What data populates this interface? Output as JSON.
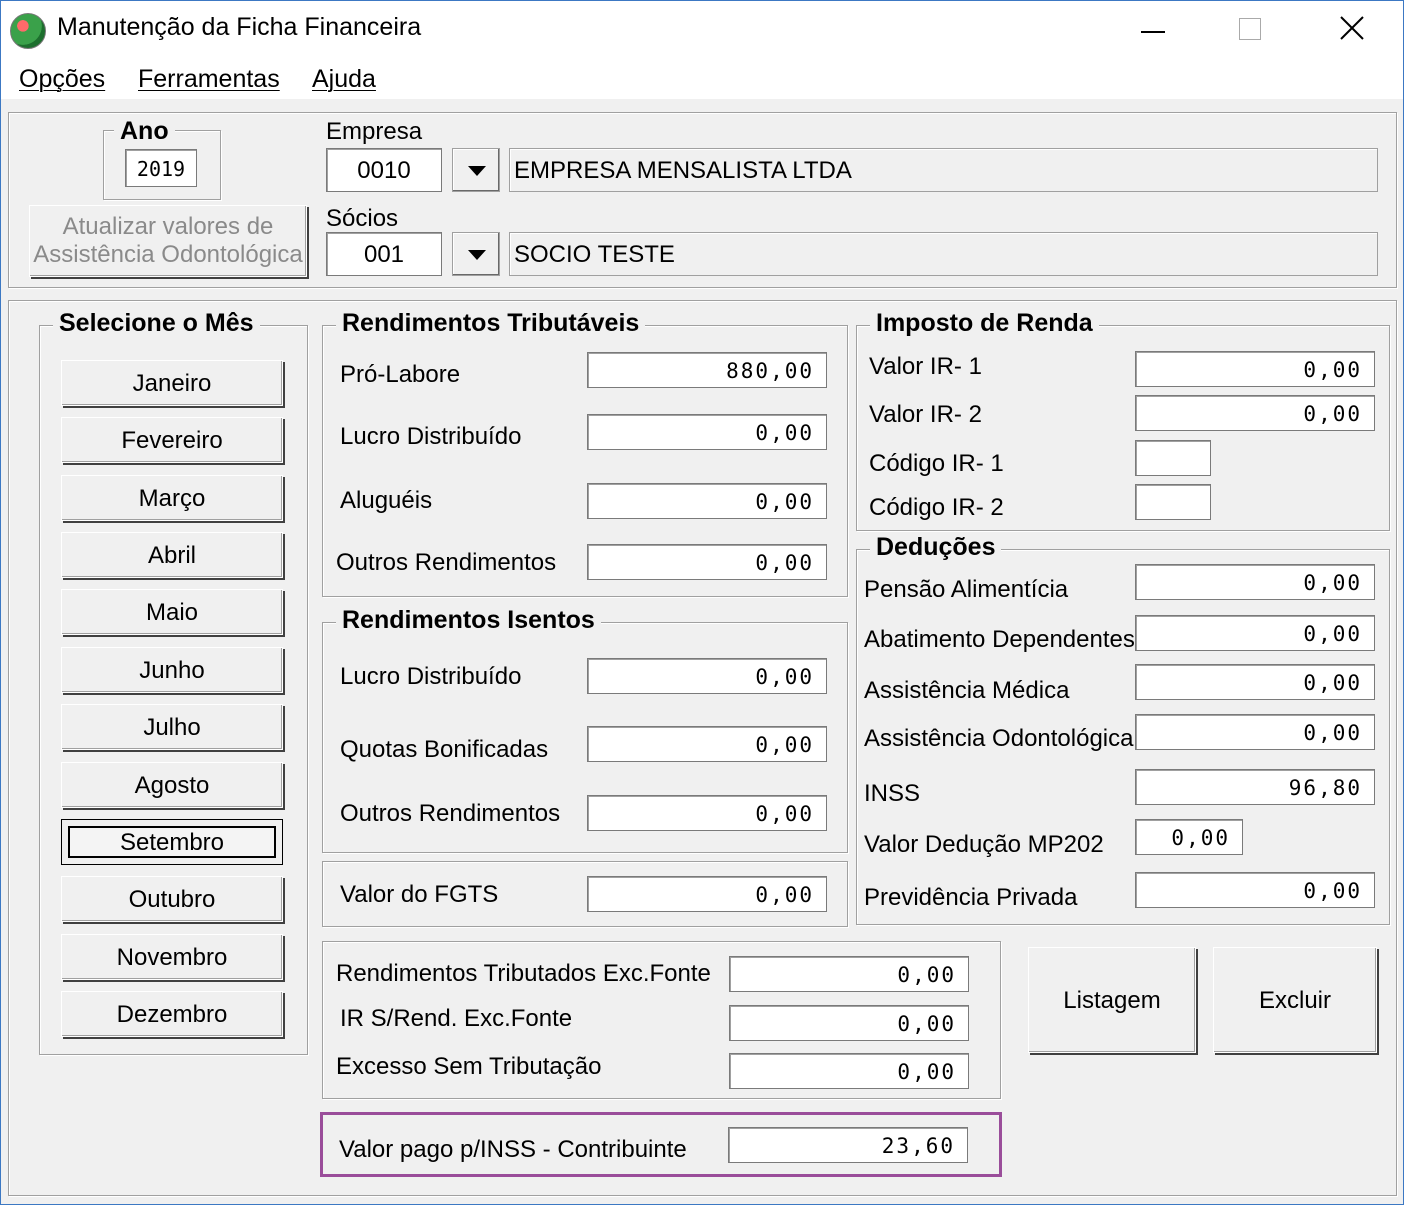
{
  "window": {
    "title": "Manutenção da Ficha Financeira"
  },
  "menu": [
    "Opções",
    "Ferramentas",
    "Ajuda"
  ],
  "header": {
    "ano_label": "Ano",
    "ano_value": "2019",
    "empresa_label": "Empresa",
    "empresa_code": "0010",
    "empresa_name": "EMPRESA MENSALISTA LTDA",
    "socios_label": "Sócios",
    "socio_code": "001",
    "socio_name": "SOCIO TESTE",
    "update_button_line1": "Atualizar valores de",
    "update_button_line2": "Assistência Odontológica"
  },
  "months": {
    "title": "Selecione o Mês",
    "items": [
      "Janeiro",
      "Fevereiro",
      "Março",
      "Abril",
      "Maio",
      "Junho",
      "Julho",
      "Agosto",
      "Setembro",
      "Outubro",
      "Novembro",
      "Dezembro"
    ],
    "selected": "Setembro"
  },
  "tributaveis": {
    "title": "Rendimentos Tributáveis",
    "rows": [
      {
        "label": "Pró-Labore",
        "value": "880,00"
      },
      {
        "label": "Lucro Distribuído",
        "value": "0,00"
      },
      {
        "label": "Aluguéis",
        "value": "0,00"
      },
      {
        "label": "Outros Rendimentos",
        "value": "0,00"
      }
    ]
  },
  "isentos": {
    "title": "Rendimentos Isentos",
    "rows": [
      {
        "label": "Lucro Distribuído",
        "value": "0,00"
      },
      {
        "label": "Quotas Bonificadas",
        "value": "0,00"
      },
      {
        "label": "Outros Rendimentos",
        "value": "0,00"
      }
    ]
  },
  "fgts": {
    "label": "Valor do FGTS",
    "value": "0,00"
  },
  "exc_fonte": {
    "rows": [
      {
        "label": "Rendimentos Tributados Exc.Fonte",
        "value": "0,00"
      },
      {
        "label": "IR S/Rend. Exc.Fonte",
        "value": "0,00"
      },
      {
        "label": "Excesso Sem Tributação",
        "value": "0,00"
      }
    ]
  },
  "inss_contribuinte": {
    "label": "Valor pago p/INSS - Contribuinte",
    "value": "23,60"
  },
  "imposto": {
    "title": "Imposto de Renda",
    "rows": [
      {
        "label": "Valor IR- 1",
        "value": "0,00"
      },
      {
        "label": "Valor IR- 2",
        "value": "0,00"
      },
      {
        "label": "Código IR- 1",
        "value": ""
      },
      {
        "label": "Código IR- 2",
        "value": ""
      }
    ]
  },
  "deducoes": {
    "title": "Deduções",
    "rows": [
      {
        "label": "Pensão Alimentícia",
        "value": "0,00"
      },
      {
        "label": "Abatimento Dependentes",
        "value": "0,00"
      },
      {
        "label": "Assistência Médica",
        "value": "0,00"
      },
      {
        "label": "Assistência Odontológica",
        "value": "0,00"
      },
      {
        "label": "INSS",
        "value": "96,80"
      },
      {
        "label": "Valor Dedução MP202",
        "value": "0,00"
      },
      {
        "label": "Previdência Privada",
        "value": "0,00"
      }
    ]
  },
  "actions": {
    "listagem": "Listagem",
    "excluir": "Excluir"
  },
  "colors": {
    "highlight": "#9a4d9a",
    "window_border": "#3c78c3"
  }
}
